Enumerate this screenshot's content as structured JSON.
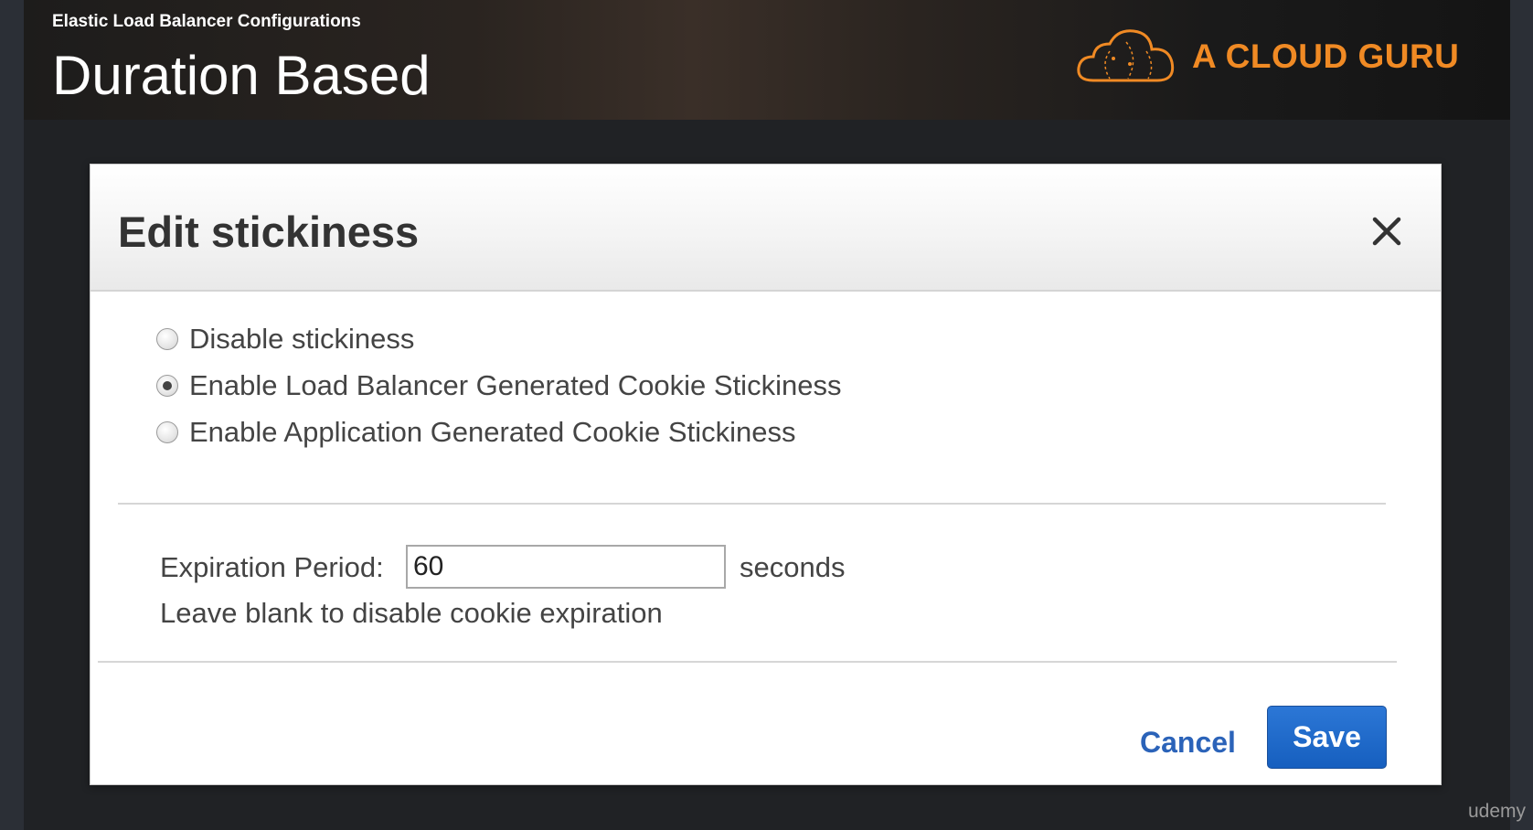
{
  "slide": {
    "subtitle": "Elastic Load Balancer Configurations",
    "title": "Duration Based"
  },
  "brand": {
    "name": "A CLOUD GURU",
    "color": "#f08a24",
    "icon": "cloud-icon"
  },
  "dialog": {
    "title": "Edit stickiness",
    "close_icon": "close-icon",
    "options": [
      {
        "label": "Disable stickiness",
        "checked": false
      },
      {
        "label": "Enable Load Balancer Generated Cookie Stickiness",
        "checked": true
      },
      {
        "label": "Enable Application Generated Cookie Stickiness",
        "checked": false
      }
    ],
    "expiration": {
      "label": "Expiration Period:",
      "value": "60",
      "unit": "seconds",
      "help": "Leave blank to disable cookie expiration"
    },
    "cancel_label": "Cancel",
    "save_label": "Save"
  },
  "watermark": "udemy"
}
